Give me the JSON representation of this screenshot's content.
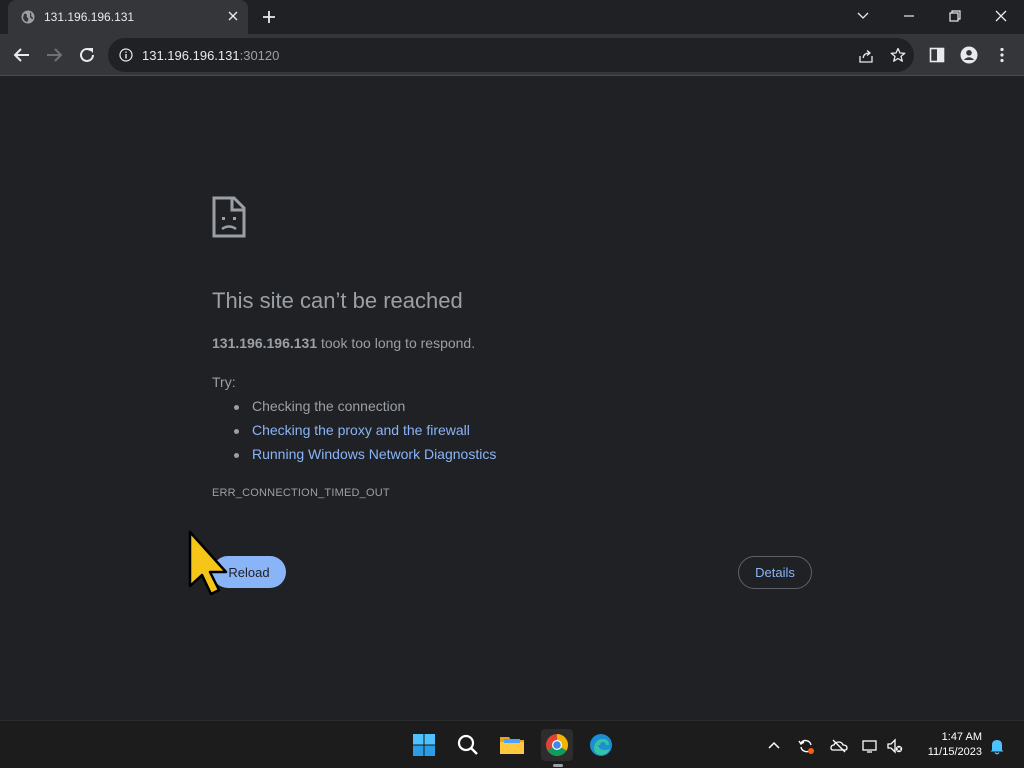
{
  "browser": {
    "tab": {
      "title": "131.196.196.131"
    },
    "address": {
      "host": "131.196.196.131",
      "port": ":30120"
    }
  },
  "error_page": {
    "heading": "This site can’t be reached",
    "host": "131.196.196.131",
    "summary_rest": " took too long to respond.",
    "try_label": "Try:",
    "suggestions": [
      {
        "text": "Checking the connection"
      },
      {
        "text": "Checking the proxy and the firewall"
      },
      {
        "text": "Running Windows Network Diagnostics"
      }
    ],
    "error_code": "ERR_CONNECTION_TIMED_OUT",
    "reload_label": "Reload",
    "details_label": "Details"
  },
  "taskbar": {
    "time": "1:47 AM",
    "date": "11/15/2023",
    "apps": [
      "start-icon",
      "search-icon",
      "file-explorer-icon",
      "chrome-icon",
      "edge-icon"
    ]
  },
  "colors": {
    "background": "#202124",
    "toolbar": "#35363a",
    "link": "#8ab4f8",
    "muted_text": "#9aa0a6"
  }
}
